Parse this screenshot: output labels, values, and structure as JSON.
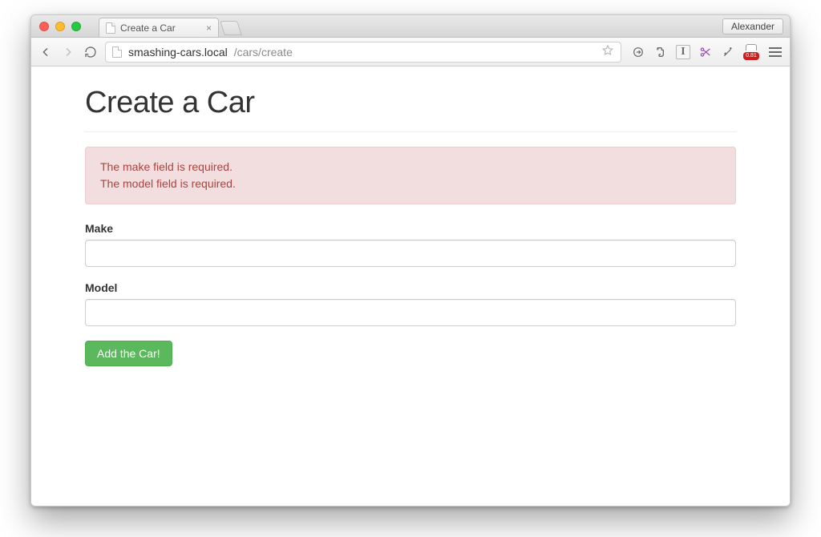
{
  "browser": {
    "profile_name": "Alexander",
    "tab": {
      "title": "Create a Car"
    },
    "url": {
      "host": "smashing-cars.local",
      "path": "/cars/create"
    },
    "extensions": {
      "letter": "I",
      "badge_value": "0.81"
    }
  },
  "page": {
    "title": "Create a Car",
    "alert": {
      "errors": [
        "The make field is required.",
        "The model field is required."
      ]
    },
    "form": {
      "make": {
        "label": "Make",
        "value": ""
      },
      "model": {
        "label": "Model",
        "value": ""
      },
      "submit_label": "Add the Car!"
    }
  }
}
